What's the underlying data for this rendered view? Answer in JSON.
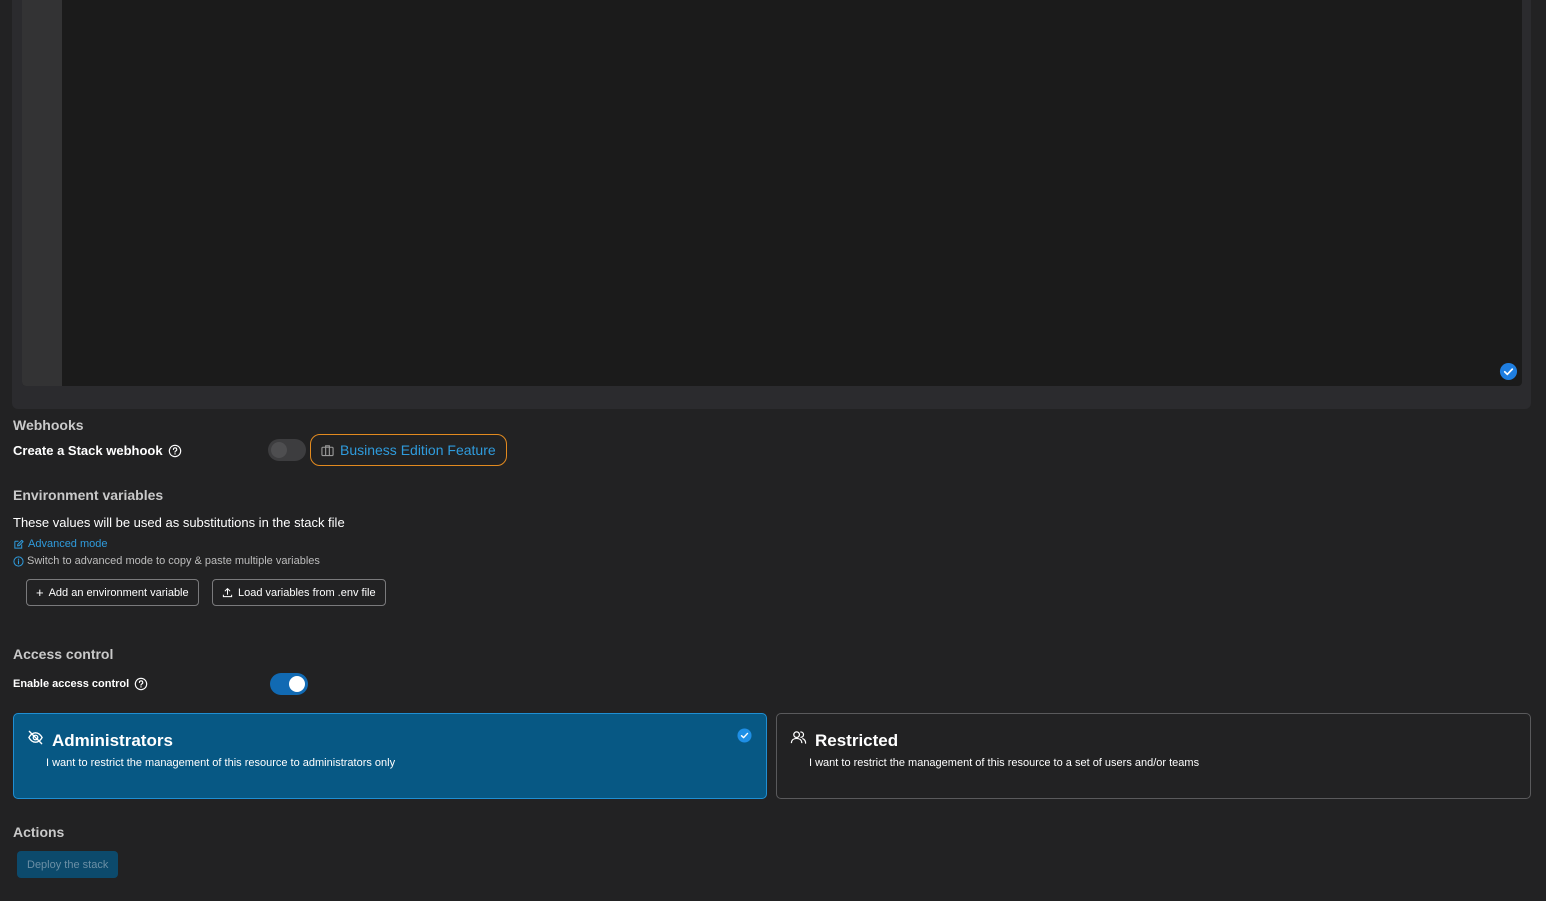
{
  "editor": {
    "valid_icon": "check-circle-icon"
  },
  "webhooks": {
    "title": "Webhooks",
    "label": "Create a Stack webhook",
    "toggle_on": false,
    "badge_label": "Business Edition Feature"
  },
  "env": {
    "title": "Environment variables",
    "description": "These values will be used as substitutions in the stack file",
    "advanced_link": "Advanced mode",
    "advanced_hint": "Switch to advanced mode to copy & paste multiple variables",
    "add_button": "Add an environment variable",
    "load_button": "Load variables from .env file"
  },
  "access": {
    "title": "Access control",
    "label": "Enable access control",
    "toggle_on": true,
    "admin_title": "Administrators",
    "admin_desc": "I want to restrict the management of this resource to administrators only",
    "restricted_title": "Restricted",
    "restricted_desc": "I want to restrict the management of this resource to a set of users and/or teams"
  },
  "actions": {
    "title": "Actions",
    "deploy_button": "Deploy the stack"
  },
  "colors": {
    "accent": "#2f9bdc",
    "selected_card": "#075884",
    "badge_border": "#e28a1f"
  }
}
